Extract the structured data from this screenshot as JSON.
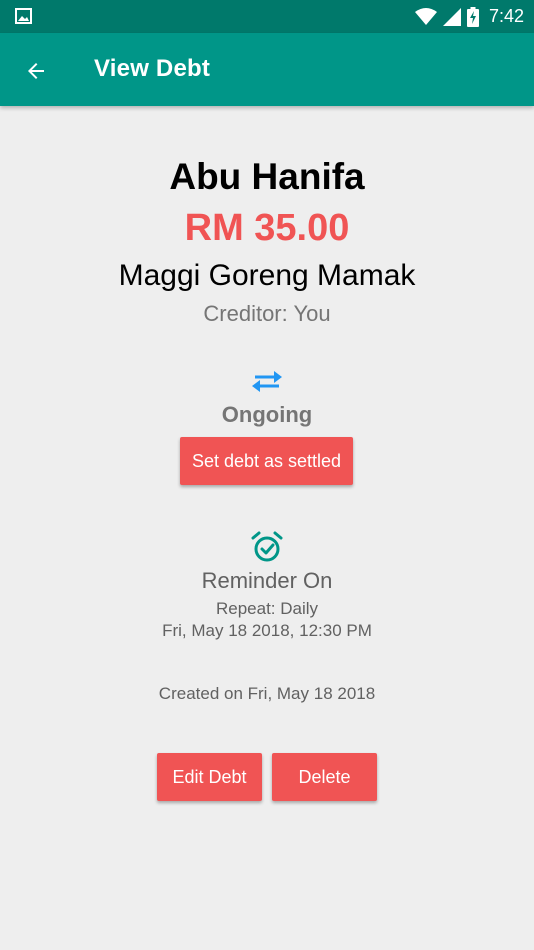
{
  "status_bar": {
    "time": "7:42",
    "icons": [
      "gallery-icon",
      "wifi-icon",
      "signal-icon",
      "battery-charging-icon"
    ]
  },
  "app_bar": {
    "title": "View Debt",
    "back_icon": "arrow-back-icon"
  },
  "debt": {
    "name": "Abu Hanifa",
    "amount": "RM 35.00",
    "description": "Maggi Goreng Mamak",
    "creditor": "Creditor: You",
    "status_icon": "swap-arrows-icon",
    "status": "Ongoing",
    "settle_label": "Set debt as settled"
  },
  "reminder": {
    "icon": "alarm-check-icon",
    "title": "Reminder On",
    "repeat": "Repeat: Daily",
    "datetime": "Fri, May 18 2018, 12:30 PM"
  },
  "created": "Created on Fri, May 18 2018",
  "actions": {
    "edit_label": "Edit Debt",
    "delete_label": "Delete"
  },
  "colors": {
    "primary": "#009688",
    "primary_dark": "#00796b",
    "accent": "#f05454",
    "status_icon": "#2196f3",
    "alarm_icon": "#009688",
    "background": "#eeeeee"
  }
}
